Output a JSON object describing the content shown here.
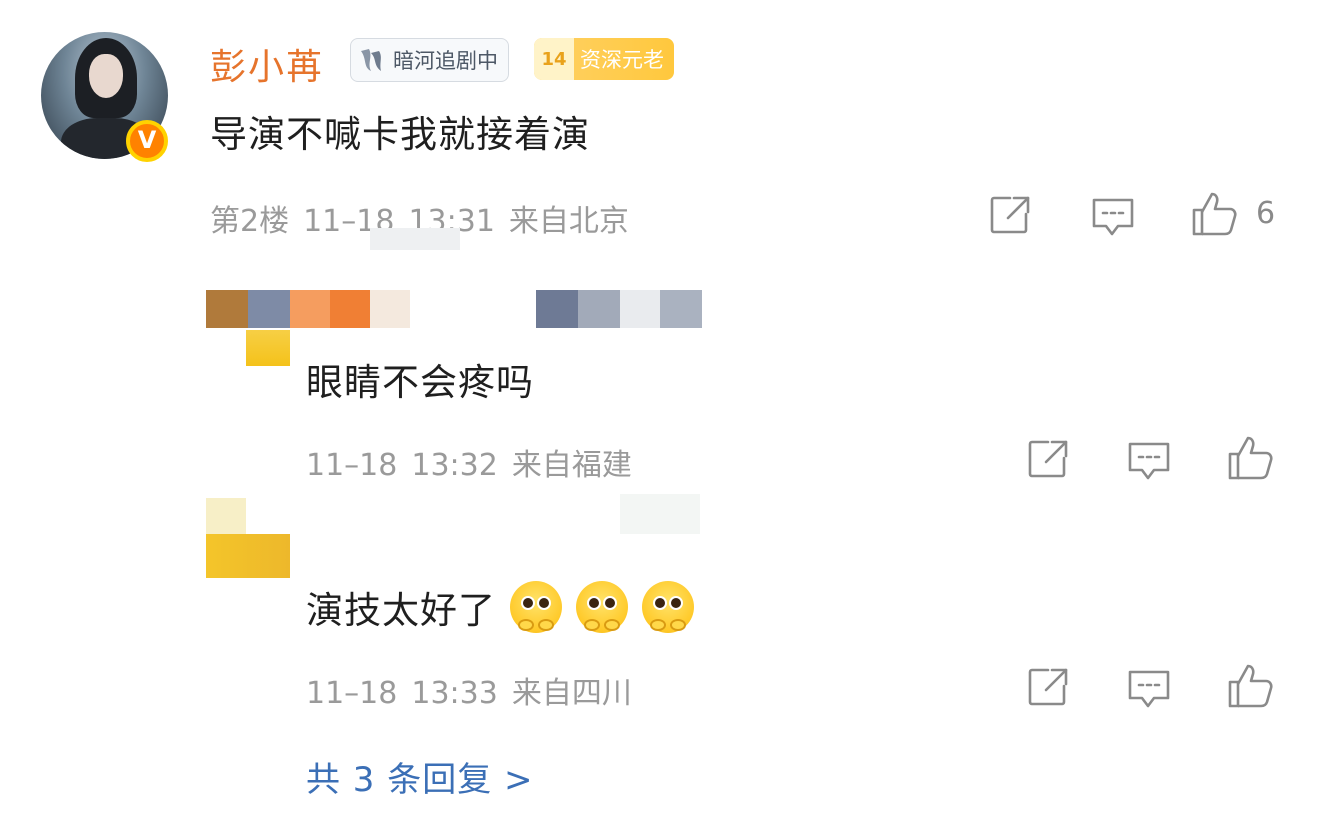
{
  "main_comment": {
    "username": "彭小苒",
    "tag_drama": "暗河追剧中",
    "tag_veteran_level": "14",
    "tag_veteran": "资深元老",
    "verified_badge": "V",
    "text": "导演不喊卡我就接着演",
    "floor": "第2楼",
    "date": "11–18",
    "time": "13:31",
    "location": "来自北京",
    "like_count": "6"
  },
  "replies": [
    {
      "text": "眼睛不会疼吗",
      "date": "11–18",
      "time": "13:32",
      "location": "来自福建",
      "emoji_count": 0
    },
    {
      "text": "演技太好了",
      "date": "11–18",
      "time": "13:33",
      "location": "来自四川",
      "emoji_count": 3
    }
  ],
  "more_replies": "共 3 条回复 >",
  "icons": {
    "share": "share-icon",
    "comment": "comment-icon",
    "like": "thumbs-up-icon"
  },
  "colors": {
    "username": "#e6742c",
    "link": "#3b6fb6",
    "meta": "#9a9a9a",
    "verified": "#ff8200"
  }
}
